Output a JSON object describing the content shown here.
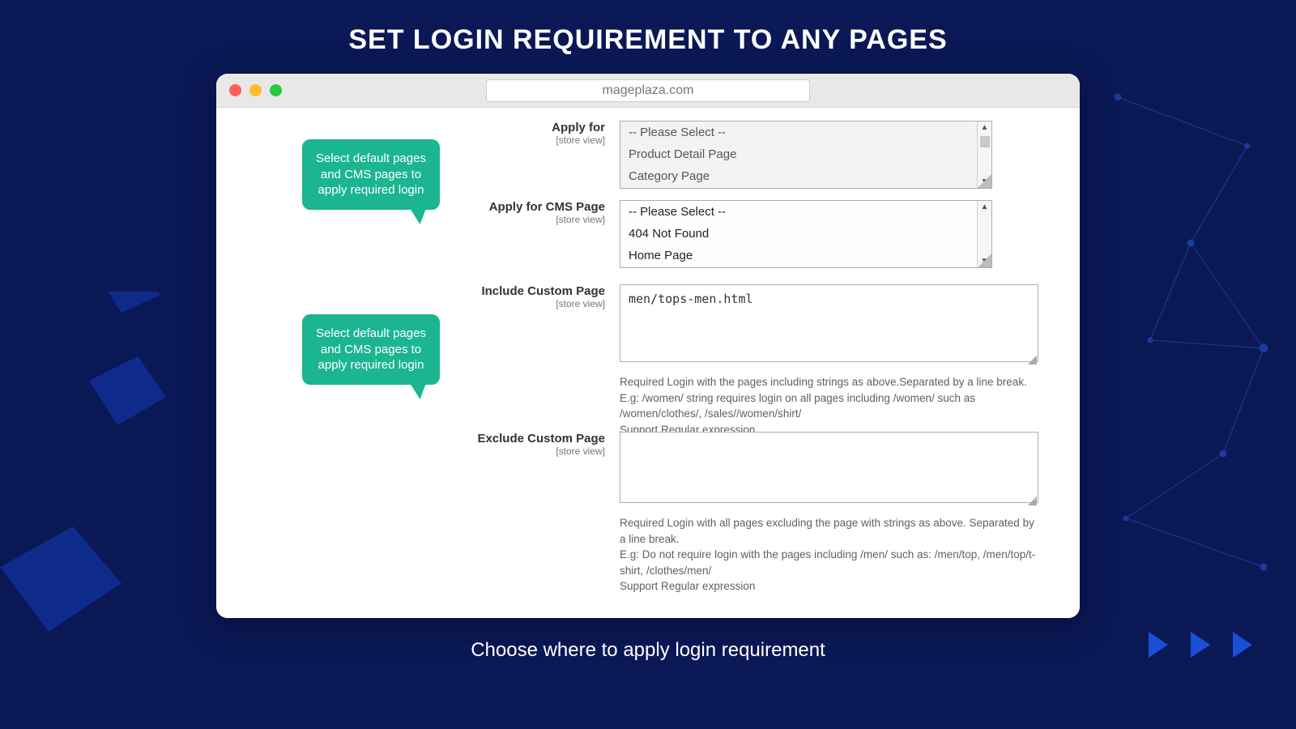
{
  "hero": {
    "title": "SET LOGIN REQUIREMENT TO ANY PAGES",
    "subtitle": "Choose where to apply login requirement"
  },
  "window": {
    "url": "mageplaza.com"
  },
  "bubbles": {
    "top": "Select default pages and CMS pages to apply required login",
    "bottom": "Select default pages and CMS pages to apply required login"
  },
  "form": {
    "scope_label": "[store view]",
    "apply_for": {
      "label": "Apply for",
      "options": [
        "-- Please Select --",
        "Product Detail Page",
        "Category Page"
      ]
    },
    "apply_cms": {
      "label": "Apply for CMS Page",
      "options": [
        "-- Please Select --",
        "404 Not Found",
        "Home Page"
      ]
    },
    "include": {
      "label": "Include Custom Page",
      "value": "men/tops-men.html",
      "help1": "Required Login with the pages including strings as above.Separated by a line break.",
      "help2": "E.g: /women/ string requires login on all pages including /women/ such as /women/clothes/, /sales//women/shirt/",
      "help3": "Support Regular expression"
    },
    "exclude": {
      "label": "Exclude Custom Page",
      "value": "",
      "help1": "Required Login with all pages excluding the page with strings as above. Separated by a line break.",
      "help2": "E.g: Do not require login with the pages including /men/ such as: /men/top, /men/top/t-shirt, /clothes/men/",
      "help3": "Support Regular expression"
    }
  }
}
